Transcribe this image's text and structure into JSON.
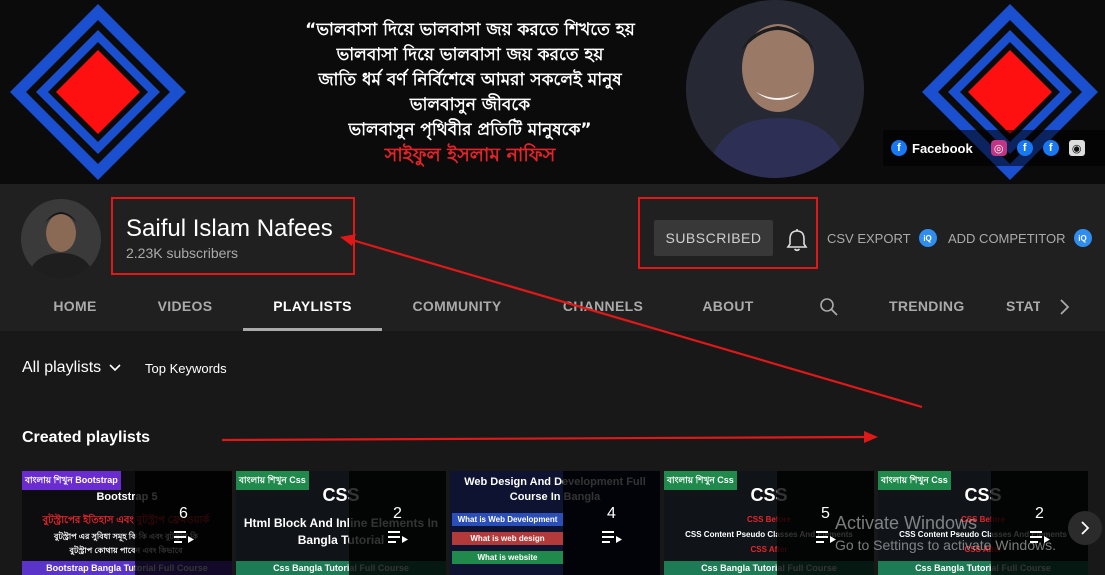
{
  "banner": {
    "quote_lines": [
      "“ভালবাসা দিয়ে ভালবাসা জয় করতে শিখতে হয়",
      "ভালবাসা দিয়ে ভালবাসা জয় করতে হয়",
      "জাতি ধর্ম বর্ণ নির্বিশেষে আমরা সকলেই মানুষ",
      "ভালবাসুন জীবকে",
      "ভালবাসুন পৃথিবীর প্রতিটি মানুষকে”"
    ],
    "quote_author": "সাইফুল ইসলাম নাফিস",
    "social": {
      "facebook_label": "Facebook",
      "icons": [
        "instagram-icon",
        "facebook-icon",
        "facebook-icon",
        "github-icon"
      ]
    },
    "colors": {
      "diamond_red": "#ff1010",
      "diamond_blue": "#1a4fd0",
      "background": "#0b0b0b"
    }
  },
  "channel": {
    "name": "Saiful Islam Nafees",
    "subscribers": "2.23K subscribers",
    "subscribe_label": "SUBSCRIBED",
    "csv_export": "CSV EXPORT",
    "add_competitor": "ADD COMPETITOR",
    "vidiq_badge": "iQ"
  },
  "tabs": [
    {
      "label": "HOME",
      "active": false
    },
    {
      "label": "VIDEOS",
      "active": false
    },
    {
      "label": "PLAYLISTS",
      "active": true
    },
    {
      "label": "COMMUNITY",
      "active": false
    },
    {
      "label": "CHANNELS",
      "active": false
    },
    {
      "label": "ABOUT",
      "active": false
    },
    {
      "label": "TRENDING",
      "active": false
    },
    {
      "label": "STAT",
      "active": false
    }
  ],
  "filters": {
    "all_playlists": "All playlists",
    "top_keywords": "Top Keywords"
  },
  "section_title": "Created playlists",
  "playlists": [
    {
      "count": "6",
      "tag": "বাংলায় শিখুন Bootstrap",
      "title": "Bootstrap 5",
      "subtitle": "বুটস্ট্রাপের ইতিহাস এবং বুটস্ট্রাপ ফ্রেমওয়ার্ক",
      "subtitle2": "বুটস্ট্রাপ এর সুবিধা সমূহ কি কি এবং বুটস্ট্রাপ কি",
      "subtitle3": "বুটস্ট্রাপ কোথায় পাবেন এবং কিভাবে",
      "bar": "Bootstrap Bangla Tutorial Full Course"
    },
    {
      "count": "2",
      "tag": "বাংলায় শিখুন Css",
      "title": "CSS",
      "subtitle": "Html Block And Inline Elements In Bangla Tutorial",
      "bar": "Css Bangla Tutorial Full Course"
    },
    {
      "count": "4",
      "title": "Web Design And Development Full Course In Bangla",
      "pills": [
        "What is Web Development",
        "What is web design",
        "What is website"
      ]
    },
    {
      "count": "5",
      "tag": "বাংলায় শিখুন Css",
      "title": "CSS",
      "lines": [
        "CSS Before",
        "CSS Content Pseudo Classes And Elements",
        "CSS After"
      ],
      "bar": "Css Bangla Tutorial Full Course"
    },
    {
      "count": "2",
      "tag": "বাংলায় শিখুন Css",
      "title": "CSS",
      "lines": [
        "CSS Before",
        "CSS Content Pseudo Classes And Elements",
        "CSS After"
      ],
      "bar": "Css Bangla Tutorial Full Course"
    }
  ],
  "watermark": {
    "line1": "Activate Windows",
    "line2": "Go to Settings to activate Windows."
  }
}
